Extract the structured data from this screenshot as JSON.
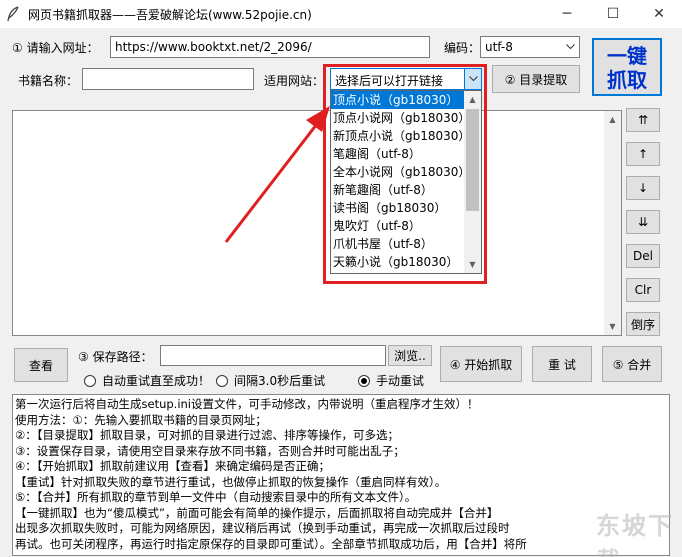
{
  "window": {
    "title": "网页书籍抓取器——吾爱破解论坛(www.52pojie.cn)",
    "min": "─",
    "max": "☐",
    "close": "✕"
  },
  "url_row": {
    "label": "① 请输入网址：",
    "value": "https://www.booktxt.net/2_2096/",
    "encoding_label": "编码：",
    "encoding_value": "utf-8"
  },
  "onekey": {
    "line1": "一键",
    "line2": "抓取"
  },
  "book_row": {
    "name_label": "书籍名称：",
    "name_value": "",
    "site_label": "适用网站：",
    "site_value": "选择后可以打开链接",
    "toc_button": "② 目录提取"
  },
  "dropdown": {
    "items": [
      "顶点小说（gb18030）",
      "顶点小说网（gb18030）",
      "新顶点小说（gb18030）",
      "笔趣阁（utf-8）",
      "全本小说网（gb18030）",
      "新笔趣阁（utf-8）",
      "读书阁（gb18030）",
      "鬼吹灯（utf-8）",
      "爪机书屋（utf-8）",
      "天籁小说（gb18030）"
    ],
    "selected_index": 0
  },
  "side_buttons": {
    "top": "⇈",
    "up": "↑",
    "down": "↓",
    "bottom": "⇊",
    "del": "Del",
    "clr": "Clr",
    "reverse": "倒序"
  },
  "save_row": {
    "view_button": "查看",
    "path_label": "③ 保存路径：",
    "path_value": "",
    "browse_button": "浏览..",
    "start_button": "④ 开始抓取",
    "retry_button": "重 试",
    "merge_button": "⑤ 合并"
  },
  "radios": {
    "auto": "自动重试直至成功！",
    "interval": "间隔3.0秒后重试",
    "manual": "手动重试",
    "selected": "manual"
  },
  "help_lines": [
    "第一次运行后将自动生成setup.ini设置文件，可手动修改，内带说明（重启程序才生效）！",
    "使用方法：①：先输入要抓取书籍的目录页网址；",
    "            ②：【目录提取】抓取目录，可对抓的目录进行过滤、排序等操作，可多选；",
    "            ③：设置保存目录，请使用空目录来存放不同书籍，否则合并时可能出乱子；",
    "            ④：【开始抓取】抓取前建议用【查看】来确定编码是否正确；",
    "                 【重试】针对抓取失败的章节进行重试，也做停止抓取的恢复操作（重启同样有效）。",
    "            ⑤：【合并】所有抓取的章节到单一文件中（自动搜索目录中的所有文本文件）。",
    "      【一键抓取】也为“傻瓜模式”，前面可能会有简单的操作提示，后面抓取将自动完成并【合并】",
    "      出现多次抓取失败时，可能为网络原因，建议稍后再试（换到手动重试，再完成一次抓取后过段时",
    "再试。也可关闭程序，再运行时指定原保存的目录即可重试）。全部章节抓取成功后，用【合并】将所"
  ],
  "watermark": "东坡下载"
}
